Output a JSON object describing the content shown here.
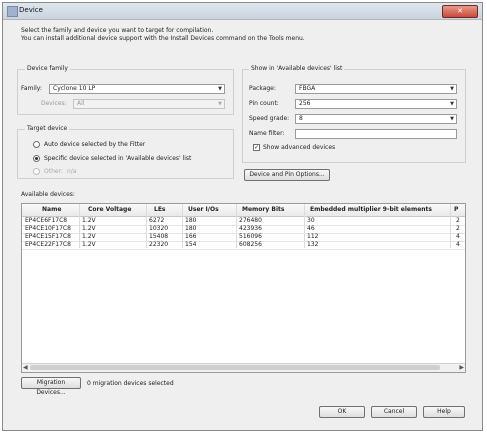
{
  "window": {
    "title": "Device",
    "close": "✕"
  },
  "intro": {
    "line1": "Select the family and device you want to target for compilation.",
    "line2": "You can install additional device support with the Install Devices command on the Tools menu."
  },
  "device_family": {
    "group_label": "Device family",
    "family_label": "Family:",
    "family_value": "Cyclone 10 LP",
    "devices_label": "Devices:",
    "devices_value": "All"
  },
  "target_device": {
    "group_label": "Target device",
    "auto_label": "Auto device selected by the Fitter",
    "specific_label": "Specific device selected in 'Available devices' list",
    "other_label": "Other:",
    "other_value": "n/a"
  },
  "show_in_list": {
    "group_label": "Show in 'Available devices' list",
    "package_label": "Package:",
    "package_value": "FBGA",
    "pincount_label": "Pin count:",
    "pincount_value": "256",
    "speed_label": "Speed grade:",
    "speed_value": "8",
    "name_filter_label": "Name filter:",
    "name_filter_value": "",
    "show_advanced_label": "Show advanced devices",
    "show_advanced_check": "✓",
    "device_pin_options_label": "Device and Pin Options..."
  },
  "available_devices": {
    "label": "Available devices:",
    "columns": [
      "Name",
      "Core Voltage",
      "LEs",
      "User I/Os",
      "Memory Bits",
      "Embedded multiplier 9-bit elements",
      "P"
    ],
    "rows": [
      [
        "EP4CE6F17C8",
        "1.2V",
        "6272",
        "180",
        "276480",
        "30",
        "2"
      ],
      [
        "EP4CE10F17C8",
        "1.2V",
        "10320",
        "180",
        "423936",
        "46",
        "2"
      ],
      [
        "EP4CE15F17C8",
        "1.2V",
        "15408",
        "166",
        "516096",
        "112",
        "4"
      ],
      [
        "EP4CE22F17C8",
        "1.2V",
        "22320",
        "154",
        "608256",
        "132",
        "4"
      ]
    ]
  },
  "footer": {
    "migration_button": "Migration Devices...",
    "migration_status": "0 migration devices selected",
    "ok": "OK",
    "cancel": "Cancel",
    "help": "Help"
  }
}
